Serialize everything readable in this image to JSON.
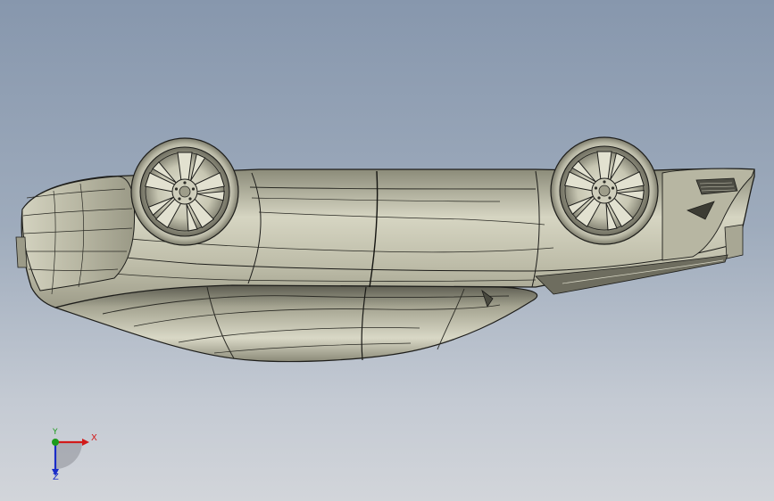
{
  "viewport": {
    "background_top": "#8797ad",
    "background_bottom": "#d2d5da",
    "model_color": "#c9c8b4",
    "edge_color": "#1d1d1a"
  },
  "triad": {
    "x_label": "X",
    "y_label": "Y",
    "z_label": "Z",
    "x_color": "#d21a1a",
    "y_color": "#1b9b1b",
    "z_color": "#1a2dc8"
  }
}
